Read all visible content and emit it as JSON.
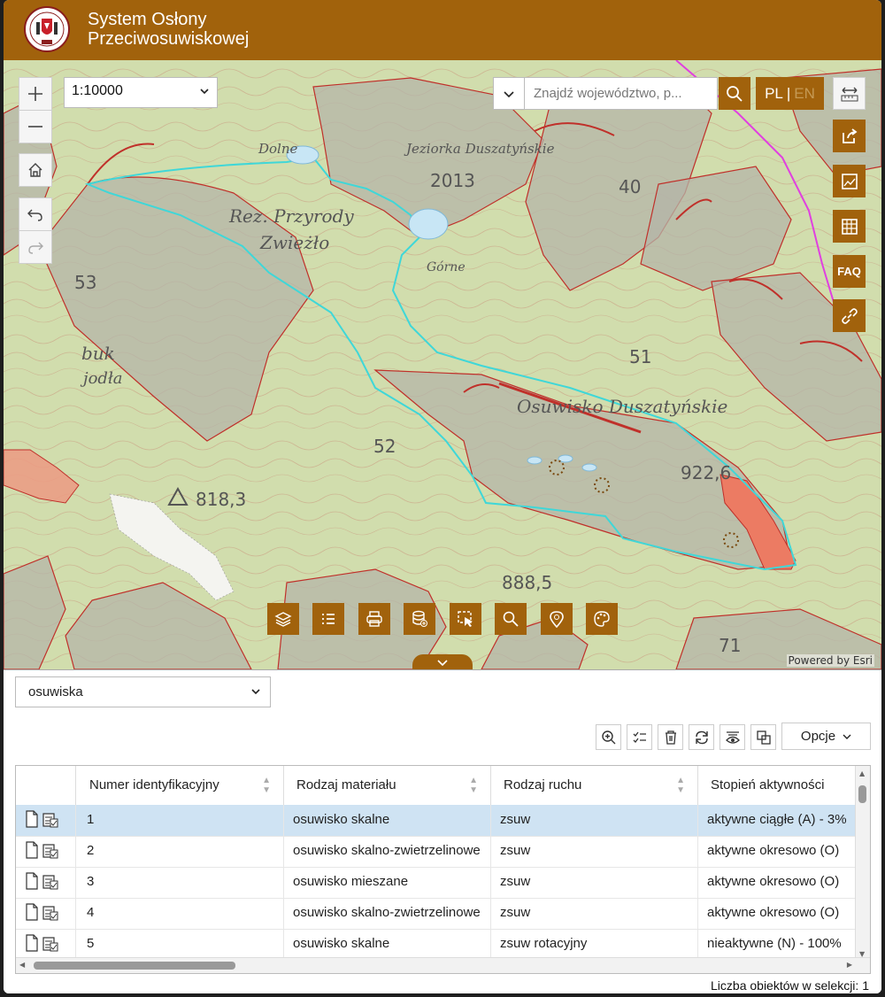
{
  "header": {
    "title_line1": "System Osłony",
    "title_line2": "Przeciwosuwiskowej"
  },
  "map": {
    "scale_value": "1:10000",
    "search_placeholder": "Znajdź województwo, p...",
    "lang_pl": "PL",
    "lang_sep": "|",
    "lang_en": "EN",
    "faq_label": "FAQ",
    "attribution": "Powered by Esri",
    "labels": {
      "dolne": "Dolne",
      "duszatynskie_top": "Jeziorka Duszatyńskie",
      "rez": "Rez. Przyrody",
      "zwiezlo": "Zwieżło",
      "gorne": "Górne",
      "n40": "40",
      "n53": "53",
      "buk": "buk",
      "jodla": "jodła",
      "n51": "51",
      "osuwisko": "Osuwisko Duszatyńskie",
      "n52": "52",
      "n922": "922,6",
      "n818": "818,3",
      "n888": "888,5",
      "n71": "71",
      "n2013": "2013"
    },
    "colors": {
      "brand": "#a1620c",
      "landslide_fill": "#b4b4a8",
      "landslide_edge": "#c0302a",
      "highlight": "#3fd7d8",
      "active": "#ec7b63",
      "topo": "#e4e0b8"
    }
  },
  "panel": {
    "layer_select": "osuwiska",
    "options_label": "Opcje",
    "columns": [
      "Numer identyfikacyjny",
      "Rodzaj materiału",
      "Rodzaj ruchu",
      "Stopień aktywności"
    ],
    "rows": [
      {
        "id": "1",
        "material": "osuwisko skalne",
        "ruch": "zsuw",
        "aktywnosc": "aktywne ciągłe (A) - 3%",
        "selected": true
      },
      {
        "id": "2",
        "material": "osuwisko skalno-zwietrzelinowe",
        "ruch": "zsuw",
        "aktywnosc": "aktywne okresowo (O)",
        "selected": false
      },
      {
        "id": "3",
        "material": "osuwisko mieszane",
        "ruch": "zsuw",
        "aktywnosc": "aktywne okresowo (O)",
        "selected": false
      },
      {
        "id": "4",
        "material": "osuwisko skalno-zwietrzelinowe",
        "ruch": "zsuw",
        "aktywnosc": "aktywne okresowo (O)",
        "selected": false
      },
      {
        "id": "5",
        "material": "osuwisko skalne",
        "ruch": "zsuw rotacyjny",
        "aktywnosc": "nieaktywne (N) - 100%",
        "selected": false
      }
    ],
    "status": "Liczba obiektów w selekcji: 1"
  }
}
